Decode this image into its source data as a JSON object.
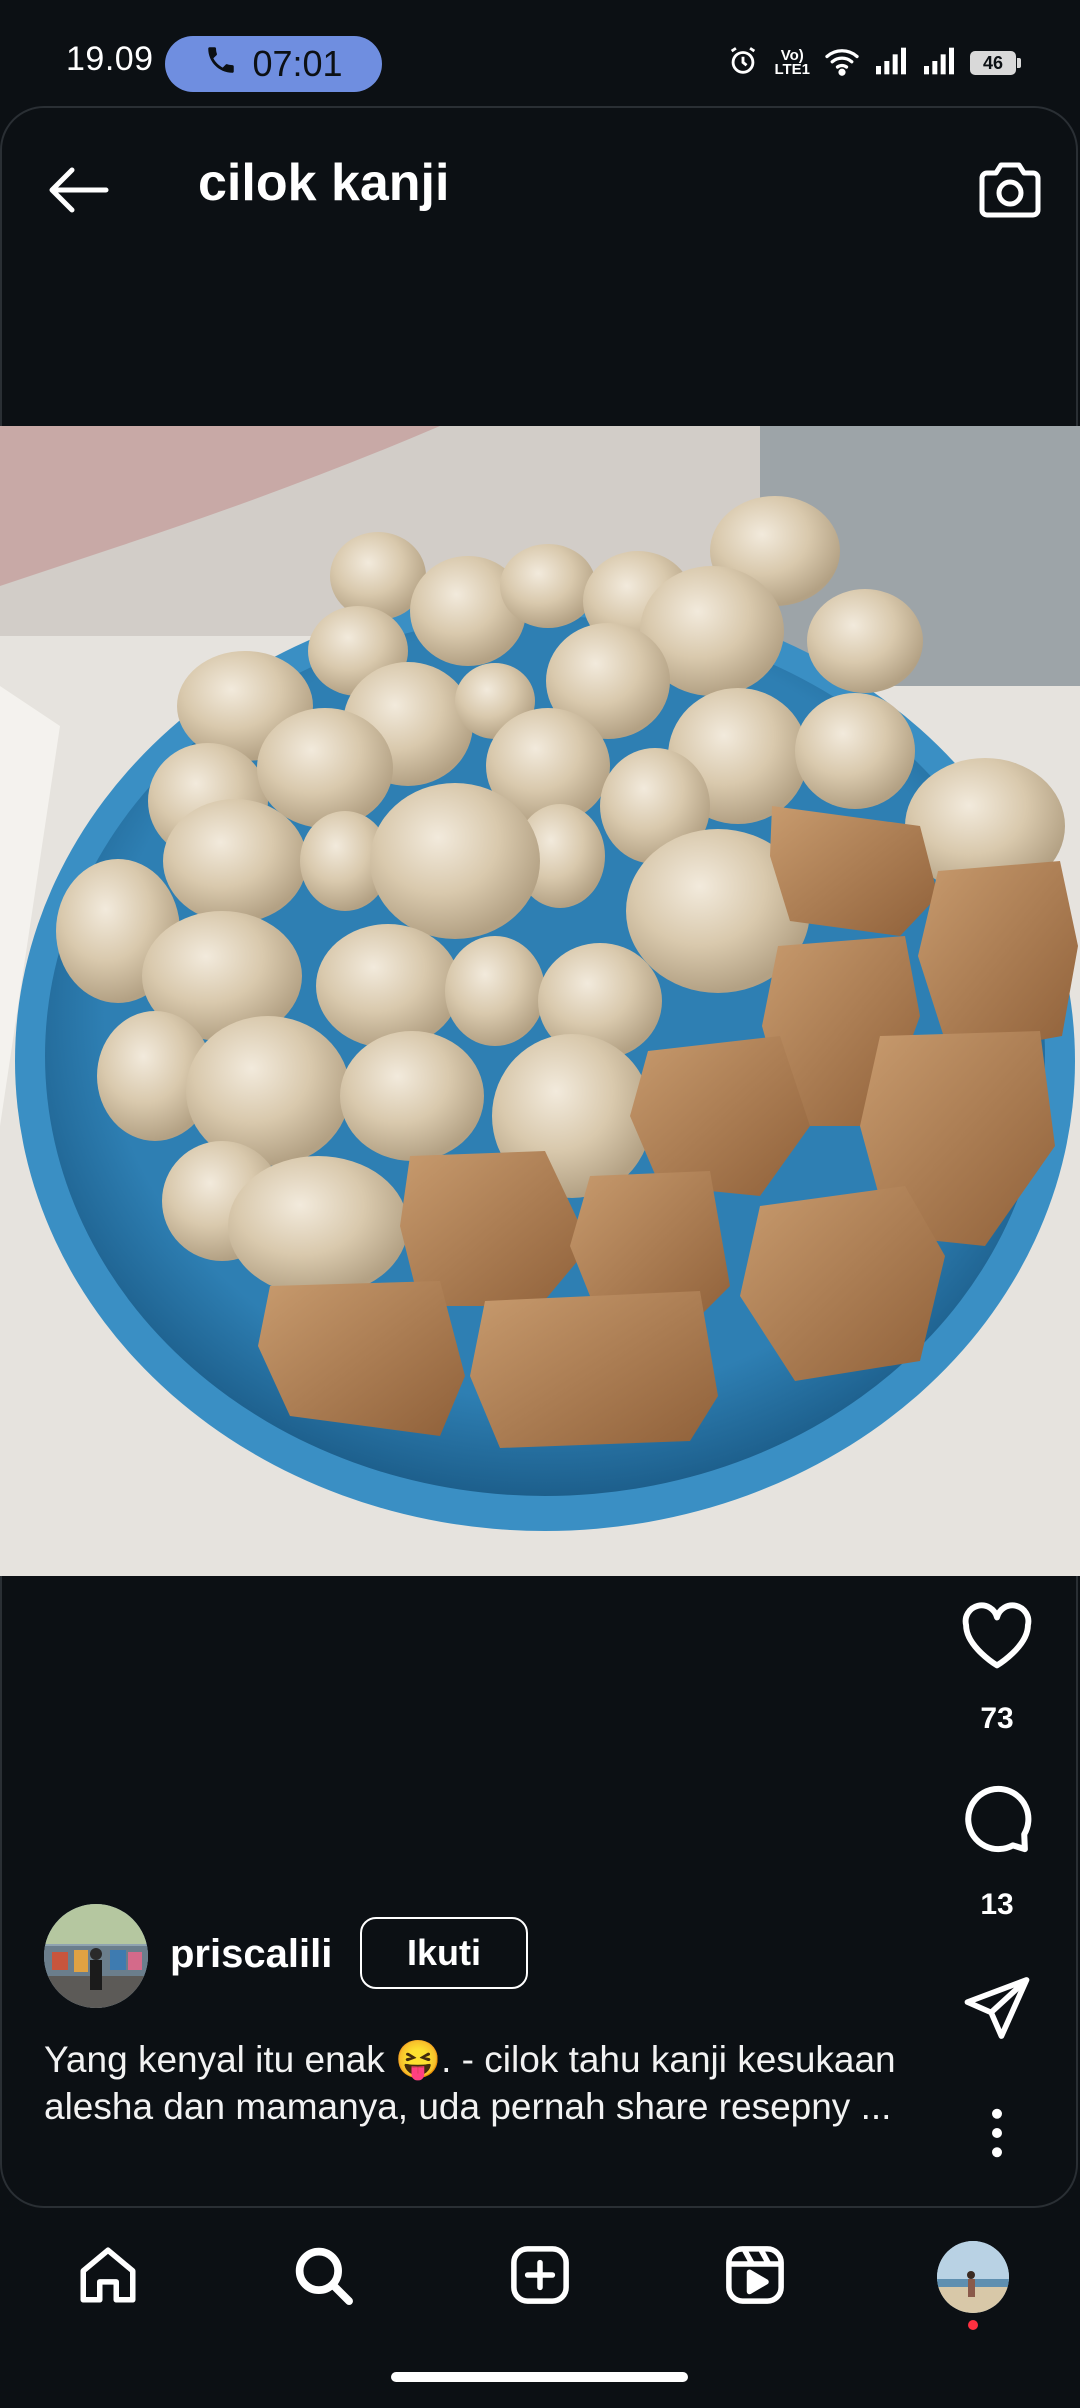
{
  "status_bar": {
    "time": "19.09",
    "call_timer": "07:01",
    "battery_level": "46",
    "icons": [
      "alarm-icon",
      "volte-icon",
      "wifi-icon",
      "signal-icon",
      "signal-icon",
      "battery-icon"
    ]
  },
  "header": {
    "title": "cilok kanji",
    "back_icon": "arrow-left-icon",
    "camera_icon": "camera-icon"
  },
  "post": {
    "image_subject": "bowl of cilok and tofu",
    "likes_count": "73",
    "comments_count": "13",
    "author": {
      "username": "priscalili",
      "follow_label": "Ikuti"
    },
    "caption": "Yang kenyal itu enak 😝. - cilok tahu kanji kesukaan alesha dan mamanya, uda pernah share resepny ..."
  },
  "bottom_nav": {
    "items": [
      "home-icon",
      "search-icon",
      "create-icon",
      "reels-icon",
      "profile-avatar"
    ]
  },
  "colors": {
    "background": "#0c1014",
    "call_pill": "#6f8ee0",
    "bowl": "#3a8fc4",
    "notification": "#ff3040"
  }
}
